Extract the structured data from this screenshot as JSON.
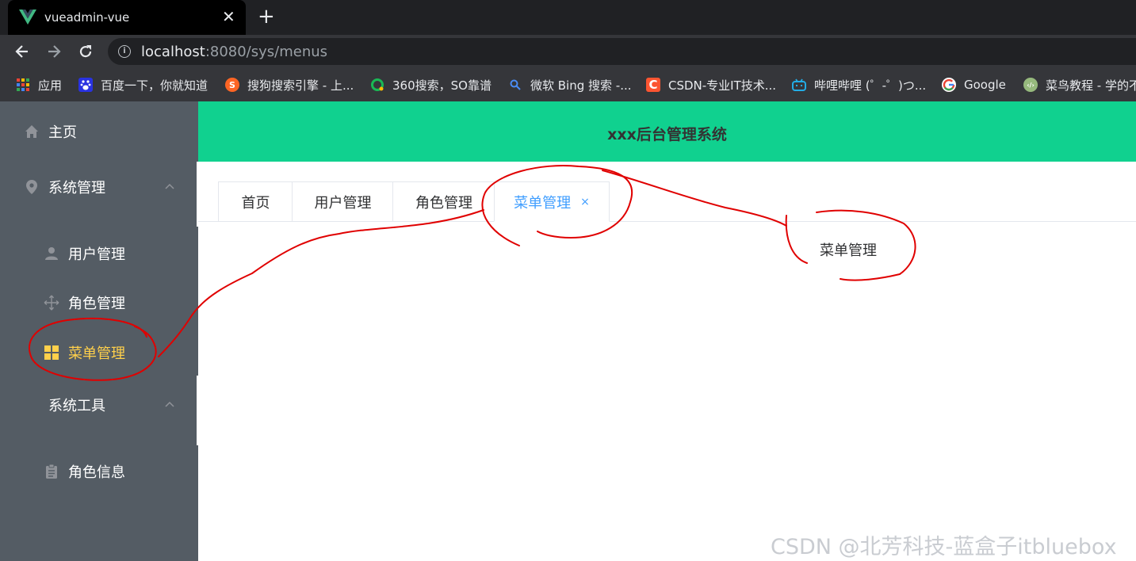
{
  "browser": {
    "tab_title": "vueadmin-vue",
    "tab_close": "✕",
    "new_tab": "+",
    "url_host": "localhost",
    "url_rest": ":8080/sys/menus",
    "bookmarks": [
      {
        "label": "应用",
        "icon": "apps-grid-icon"
      },
      {
        "label": "百度一下，你就知道",
        "icon": "baidu-icon"
      },
      {
        "label": "搜狗搜索引擎 - 上...",
        "icon": "sogou-icon"
      },
      {
        "label": "360搜索，SO靠谱",
        "icon": "360-search-icon"
      },
      {
        "label": "微软 Bing 搜索 -...",
        "icon": "bing-search-icon"
      },
      {
        "label": "CSDN-专业IT技术...",
        "icon": "csdn-icon"
      },
      {
        "label": "哔哩哔哩 (゜-゜)つ...",
        "icon": "bilibili-icon"
      },
      {
        "label": "Google",
        "icon": "google-icon"
      },
      {
        "label": "菜鸟教程 - 学的不",
        "icon": "runoob-icon"
      }
    ]
  },
  "sidebar": {
    "items": [
      {
        "label": "主页",
        "icon": "home-icon"
      },
      {
        "label": "系统管理",
        "icon": "location-icon"
      },
      {
        "label": "用户管理",
        "icon": "user-icon"
      },
      {
        "label": "角色管理",
        "icon": "rank-icon"
      },
      {
        "label": "菜单管理",
        "icon": "menu-grid-icon",
        "active": true
      },
      {
        "label": "系统工具",
        "icon": ""
      },
      {
        "label": "角色信息",
        "icon": "clipboard-icon"
      }
    ],
    "active_color": "#ffd04b",
    "background": "#545c64"
  },
  "header": {
    "title": "xxx后台管理系统",
    "background": "#10d18f"
  },
  "tabs": [
    {
      "label": "首页"
    },
    {
      "label": "用户管理"
    },
    {
      "label": "角色管理"
    },
    {
      "label": "菜单管理",
      "active": true,
      "close": "×"
    }
  ],
  "content": {
    "text": "菜单管理"
  },
  "watermark": "CSDN @北芳科技-蓝盒子itbluebox",
  "colors": {
    "accent": "#409eff",
    "annotation": "#e00000"
  }
}
